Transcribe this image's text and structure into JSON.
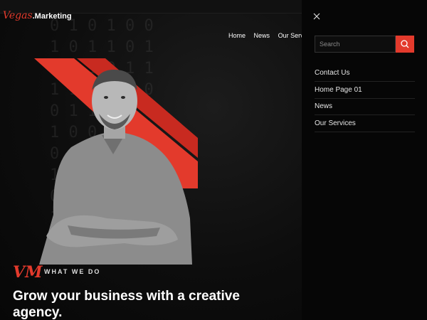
{
  "brand": {
    "script": "Vegas",
    "bold": ".Marketing"
  },
  "nav": [
    "Home",
    "News",
    "Our Servi"
  ],
  "hero": {
    "monogram": "VM",
    "eyebrow": "WHAT WE DO",
    "headline": "Grow your business with a creative agency."
  },
  "panel": {
    "search_placeholder": "Search",
    "menu": [
      "Contact Us",
      "Home Page 01",
      "News",
      "Our Services"
    ]
  },
  "colors": {
    "accent": "#e33a2c",
    "background": "#0b0b0b"
  },
  "icons": {
    "close": "close-icon",
    "search": "search-icon"
  }
}
